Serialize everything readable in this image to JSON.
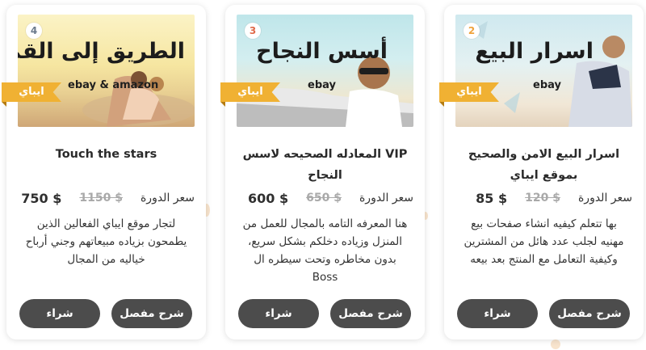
{
  "cards": [
    {
      "number": "2",
      "ribbon": "ايباي",
      "art_title": "اسرار البيع",
      "art_brand": "ebay",
      "title": "اسرار البيع الامن والصحيح بموقع ايباي",
      "price_label": "سعر الدورة",
      "old_price": "120 $",
      "new_price": "85 $",
      "description": "بها تتعلم كيفيه انشاء صفحات بيع مهنيه لجلب عدد هائل من المشترين وكيفية التعامل مع المنتج بعد بيعه",
      "detail_button": "شرح مفصل",
      "buy_button": "شراء"
    },
    {
      "number": "3",
      "ribbon": "ايباي",
      "art_title": "أسس النجاح",
      "art_brand": "ebay",
      "title": "VIP المعادله الصحيحه لاسس النجاح",
      "price_label": "سعر الدورة",
      "old_price": "650 $",
      "new_price": "600 $",
      "description": "هنا المعرفه التامه بالمجال للعمل من المنزل وزياده دخلكم بشكل سريع، بدون مخاطره وتحت سيطره ال Boss",
      "detail_button": "شرح مفصل",
      "buy_button": "شراء"
    },
    {
      "number": "4",
      "ribbon": "ايباي",
      "art_title": "الطريق إلى القمه",
      "art_brand": "ebay & amazon",
      "title": "Touch the stars",
      "price_label": "سعر الدورة",
      "old_price": "1150 $",
      "new_price": "750 $",
      "description": "لتجار موقع ايباي الفعالين الذين يطمحون بزياده مبيعاتهم وجني أرباح خياليه من المجال",
      "detail_button": "شرح مفصل",
      "buy_button": "شراء"
    }
  ],
  "colors": {
    "ribbon": "#f0b133",
    "button": "#4c4c4c",
    "old_price": "#a9a9a9",
    "badge_2": "#f0a33c",
    "badge_3": "#e06a4a",
    "badge_4": "#6b7a8c"
  },
  "icons": {
    "number_badge": "circle-number-icon",
    "ribbon": "ribbon-tag-icon"
  }
}
